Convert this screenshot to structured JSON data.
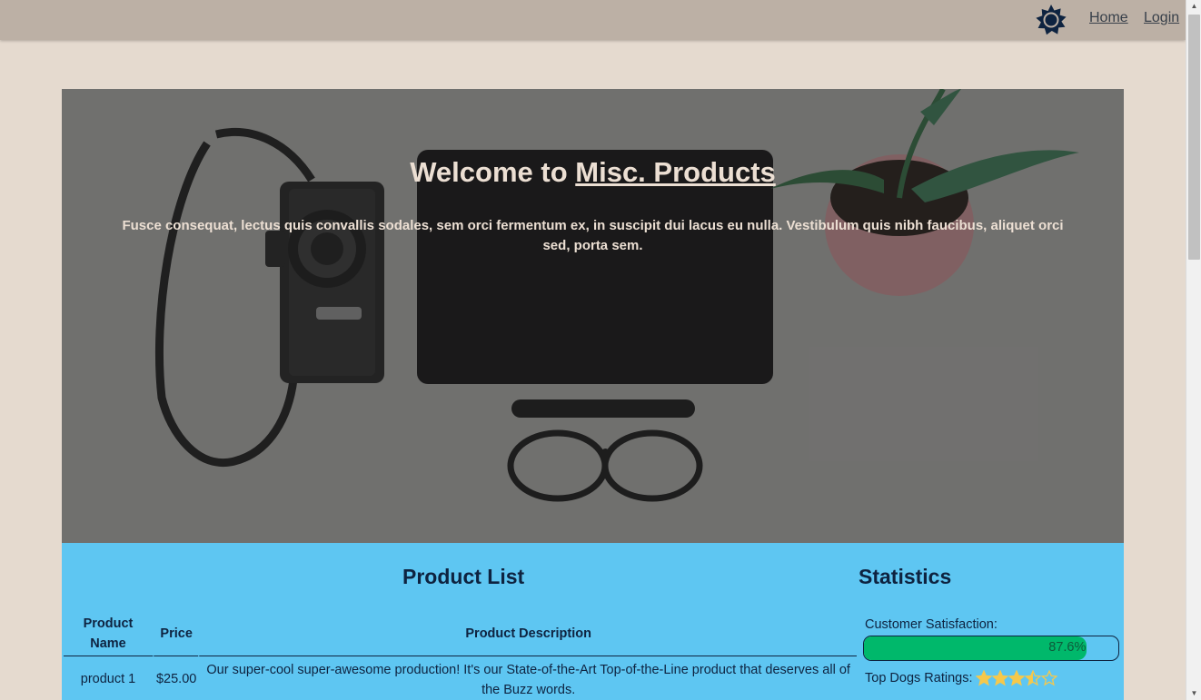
{
  "nav": {
    "theme_icon": "sun-icon",
    "home_label": "Home",
    "login_label": "Login"
  },
  "hero": {
    "title_prefix": "Welcome to ",
    "title_link": "Misc. Products",
    "text": "Fusce consequat, lectus quis convallis sodales, sem orci fermentum ex, in suscipit dui lacus eu nulla. Vestibulum quis nibh faucibus, aliquet orci sed, porta sem."
  },
  "products": {
    "title": "Product List",
    "columns": [
      "Product Name",
      "Price",
      "Product Description"
    ],
    "rows": [
      {
        "name": "product 1",
        "price": "$25.00",
        "description": "Our super-cool super-awesome production! It's our State-of-the-Art Top-of-the-Line product that deserves all of the Buzz words."
      }
    ]
  },
  "stats": {
    "title": "Statistics",
    "satisfaction_label": "Customer Satisfaction:",
    "satisfaction_value": "87.6%",
    "satisfaction_fraction": 0.876,
    "ratings_label": "Top Dogs Ratings:",
    "rating": 3.5,
    "rating_max": 5
  },
  "colors": {
    "page_bg": "#e5dacf",
    "topbar": "#bcb0a5",
    "content_bg": "#5ec6f2",
    "text_dark": "#0e2340",
    "progress_fill": "#00b86b",
    "star": "#f5c84c"
  }
}
